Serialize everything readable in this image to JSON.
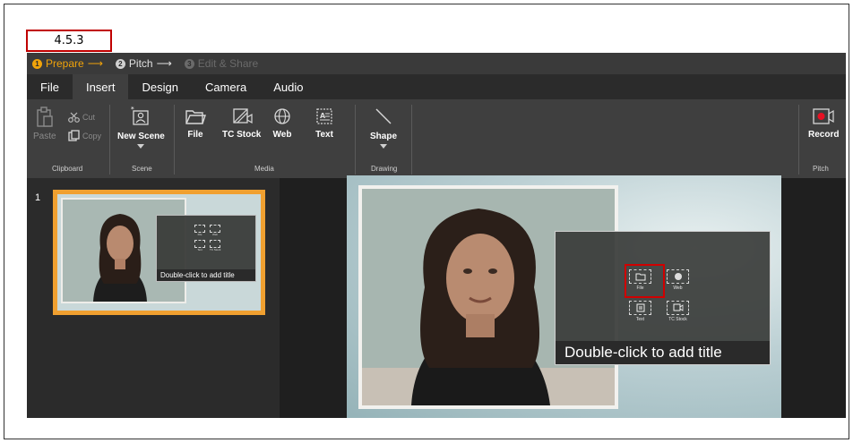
{
  "step_label": "4.5.3",
  "workflow": {
    "steps": [
      {
        "num": "1",
        "label": "Prepare",
        "arrow": "⟶"
      },
      {
        "num": "2",
        "label": "Pitch",
        "arrow": "⟶"
      },
      {
        "num": "3",
        "label": "Edit & Share"
      }
    ]
  },
  "tabs": [
    "File",
    "Insert",
    "Design",
    "Camera",
    "Audio"
  ],
  "ribbon": {
    "clipboard": {
      "paste": "Paste",
      "cut": "Cut",
      "copy": "Copy",
      "group": "Clipboard"
    },
    "scene": {
      "new_scene": "New Scene",
      "group": "Scene"
    },
    "media": {
      "file": "File",
      "tc_stock": "TC Stock",
      "web": "Web",
      "text": "Text",
      "group": "Media"
    },
    "drawing": {
      "shape": "Shape",
      "group": "Drawing"
    },
    "pitch": {
      "record": "Record",
      "group": "Pitch"
    }
  },
  "scene_list": {
    "number": "1",
    "thumb_title": "Double-click to add title",
    "thumb_tiles": {
      "file": "File",
      "web": "Web",
      "text": "Text",
      "tc_stock": "TC Stock"
    }
  },
  "stage": {
    "title_placeholder": "Double-click to add title",
    "tiles": {
      "file": "File",
      "web": "Web",
      "text": "Text",
      "tc_stock": "TC Stock"
    }
  },
  "colors": {
    "accent": "#f0a30a",
    "highlight": "#d00000",
    "record": "#e81123"
  }
}
